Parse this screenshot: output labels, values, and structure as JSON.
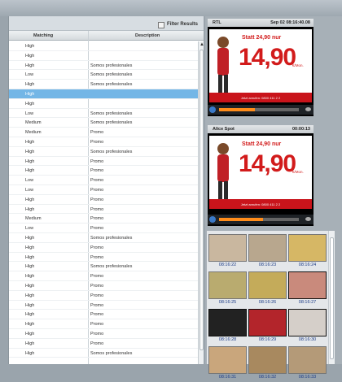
{
  "filter": {
    "label": "Filter Results",
    "checked": false
  },
  "table": {
    "headers": {
      "matching": "Matching",
      "description": "Description"
    },
    "rows": [
      {
        "matching": "High",
        "description": ""
      },
      {
        "matching": "High",
        "description": ""
      },
      {
        "matching": "High",
        "description": "Somos profesionales"
      },
      {
        "matching": "Low",
        "description": "Somos profesionales"
      },
      {
        "matching": "High",
        "description": "Somos profesionales"
      },
      {
        "matching": "High",
        "description": "",
        "selected": true
      },
      {
        "matching": "High",
        "description": ""
      },
      {
        "matching": "Low",
        "description": "Somos profesionales"
      },
      {
        "matching": "Medium",
        "description": "Somos profesionales"
      },
      {
        "matching": "Medium",
        "description": "Promo"
      },
      {
        "matching": "High",
        "description": "Promo"
      },
      {
        "matching": "High",
        "description": "Somos profesionales"
      },
      {
        "matching": "High",
        "description": "Promo"
      },
      {
        "matching": "High",
        "description": "Promo"
      },
      {
        "matching": "Low",
        "description": "Promo"
      },
      {
        "matching": "Low",
        "description": "Promo"
      },
      {
        "matching": "High",
        "description": "Promo"
      },
      {
        "matching": "High",
        "description": "Promo"
      },
      {
        "matching": "Medium",
        "description": "Promo"
      },
      {
        "matching": "Low",
        "description": "Promo"
      },
      {
        "matching": "High",
        "description": "Somos profesionales"
      },
      {
        "matching": "High",
        "description": "Promo"
      },
      {
        "matching": "High",
        "description": "Promo"
      },
      {
        "matching": "High",
        "description": "Somos profesionales"
      },
      {
        "matching": "High",
        "description": "Promo"
      },
      {
        "matching": "High",
        "description": "Promo"
      },
      {
        "matching": "High",
        "description": "Promo"
      },
      {
        "matching": "High",
        "description": "Promo"
      },
      {
        "matching": "High",
        "description": "Promo"
      },
      {
        "matching": "High",
        "description": "Promo"
      },
      {
        "matching": "High",
        "description": "Promo"
      },
      {
        "matching": "High",
        "description": "Promo"
      },
      {
        "matching": "High",
        "description": "Somos profesionales"
      }
    ]
  },
  "player1": {
    "channel": "RTL",
    "datetime": "Sep 02 08:16:40.08",
    "ad": {
      "statt": "Statt 24,90 nur",
      "price": "14,90",
      "unit": "€/Mon.",
      "strip": "Jetzt anrufen: 0800 411 2 2"
    },
    "progress": 0.45
  },
  "player2": {
    "title": "Alice Spot",
    "time": "00:00:13",
    "ad": {
      "statt": "Statt 24,90 nur",
      "price": "14,90",
      "unit": "€/Mon.",
      "strip": "Jetzt anrufen: 0800 411 2 2"
    },
    "progress": 0.55
  },
  "thumbnails": [
    {
      "tc": "08:16:22",
      "color": "#c9b79f",
      "active": false
    },
    {
      "tc": "08:16:23",
      "color": "#b8a78e",
      "active": false
    },
    {
      "tc": "08:16:24",
      "color": "#d6b765",
      "active": false
    },
    {
      "tc": "08:16:25",
      "color": "#b9ab6f",
      "active": false
    },
    {
      "tc": "08:16:26",
      "color": "#c4ab5a",
      "active": false
    },
    {
      "tc": "08:16:27",
      "color": "#c98a7c",
      "active": true
    },
    {
      "tc": "08:16:28",
      "color": "#222222",
      "active": true
    },
    {
      "tc": "08:16:29",
      "color": "#b3252b",
      "active": true
    },
    {
      "tc": "08:16:30",
      "color": "#d5cfc9",
      "active": true
    },
    {
      "tc": "08:16:31",
      "color": "#c9a67c",
      "active": false
    },
    {
      "tc": "08:16:32",
      "color": "#a8895f",
      "active": false
    },
    {
      "tc": "08:16:33",
      "color": "#b49a78",
      "active": false
    }
  ]
}
